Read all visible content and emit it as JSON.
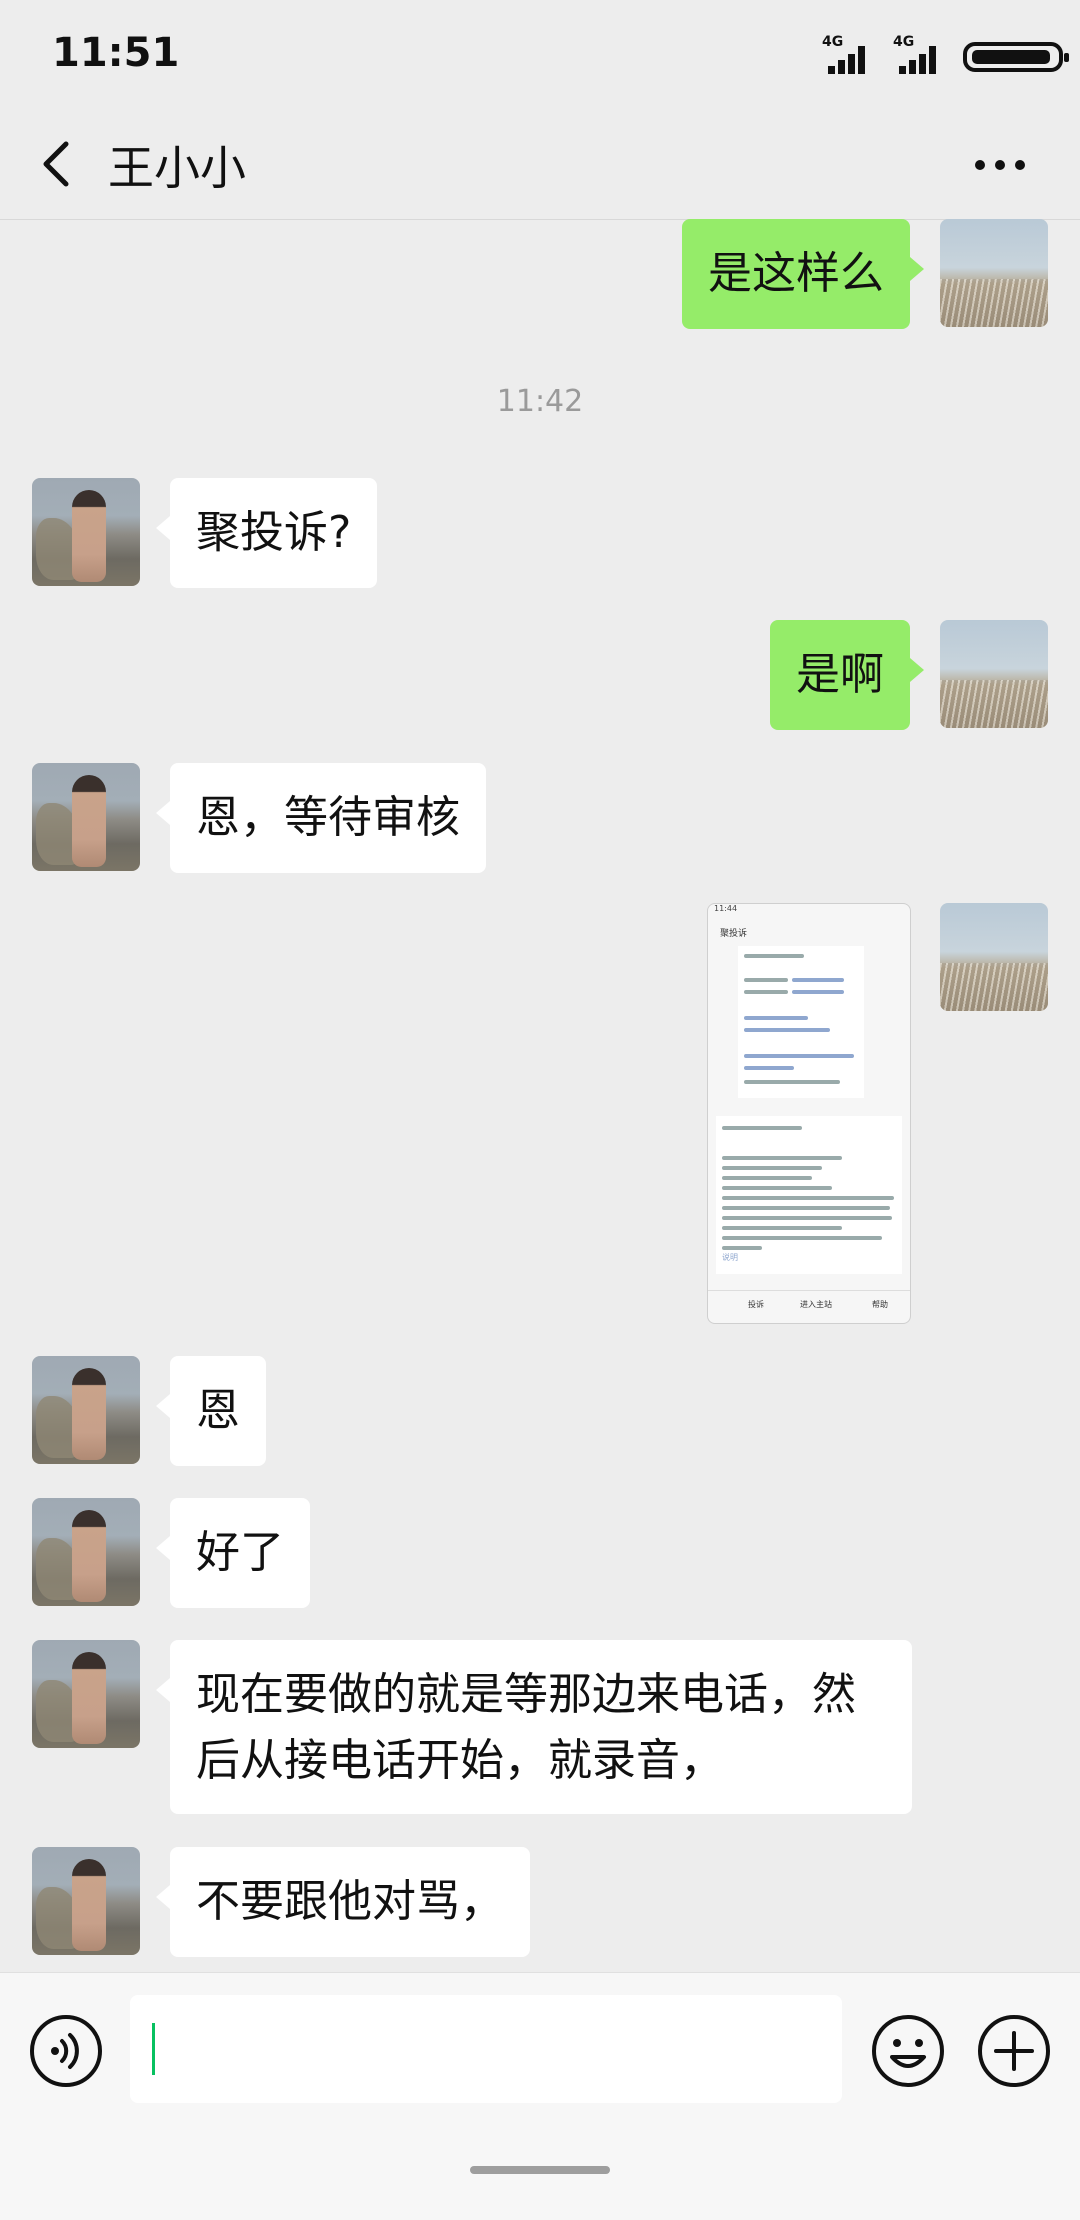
{
  "status_bar": {
    "time": "11:51",
    "network_1": "4G",
    "network_2": "4G"
  },
  "header": {
    "title": "王小小"
  },
  "messages": [
    {
      "from": "me",
      "text": "是这样么"
    },
    {
      "type": "time",
      "text": "11:42"
    },
    {
      "from": "peer",
      "text": "聚投诉?"
    },
    {
      "from": "me",
      "text": "是啊"
    },
    {
      "from": "peer",
      "text": "恩，等待审核"
    },
    {
      "from": "me",
      "type": "image",
      "screenshot": {
        "time": "11:44",
        "title": "聚投诉",
        "card_footer": "说明",
        "footer_left": "投诉",
        "footer_mid": "进入主站",
        "footer_right": "帮助"
      }
    },
    {
      "from": "peer",
      "text": "恩"
    },
    {
      "from": "peer",
      "text": "好了"
    },
    {
      "from": "peer",
      "text": "现在要做的就是等那边来电话，然后从接电话开始，就录音，"
    },
    {
      "from": "peer",
      "text": "不要跟他对骂，"
    }
  ],
  "input": {
    "value": "",
    "placeholder": ""
  },
  "colors": {
    "background": "#ededed",
    "bubble_in": "#ffffff",
    "bubble_out": "#95ec69",
    "cursor": "#07c160"
  },
  "icons": [
    "back-icon",
    "more-icon",
    "voice-icon",
    "emoji-icon",
    "plus-icon"
  ]
}
